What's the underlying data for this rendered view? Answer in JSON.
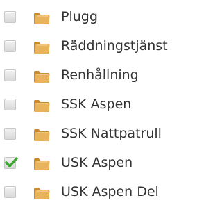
{
  "tree": {
    "items": [
      {
        "label": "Plugg",
        "checked": false
      },
      {
        "label": "Räddningstjänst",
        "checked": false
      },
      {
        "label": "Renhållning",
        "checked": false
      },
      {
        "label": "SSK Aspen",
        "checked": false
      },
      {
        "label": "SSK Nattpatrull",
        "checked": false
      },
      {
        "label": "USK Aspen",
        "checked": true
      },
      {
        "label": "USK Aspen Del",
        "checked": false
      }
    ],
    "icons": {
      "checkbox": "checkbox-icon",
      "checkmark": "checkmark-icon",
      "folder": "folder-icon"
    },
    "colors": {
      "text": "#333333",
      "checkmark": "#3aa52f",
      "folder": "#e9b35b"
    }
  }
}
